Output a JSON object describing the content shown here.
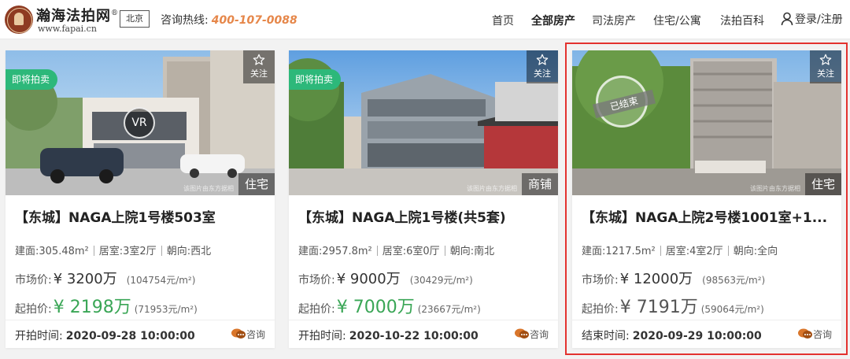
{
  "header": {
    "brand": "瀚海法拍网",
    "brand_mark": "®",
    "domain": "www.fapai.cn",
    "city": "北京",
    "hotline_label": "咨询热线:",
    "hotline_number": "400-107-0088",
    "nav": [
      {
        "label": "首页",
        "active": false
      },
      {
        "label": "全部房产",
        "active": true
      },
      {
        "label": "司法房产",
        "active": false
      },
      {
        "label": "住宅/公寓",
        "active": false
      },
      {
        "label": "法拍百科",
        "active": false
      }
    ],
    "login": "登录/注册"
  },
  "cards": [
    {
      "status_badge": "即将拍卖",
      "fav_label": "关注",
      "type": "住宅",
      "vr": "VR",
      "watermark": "该图片由东方据相",
      "title": "【东城】NAGA上院1号楼503室",
      "spec": {
        "area": "建面:305.48m²",
        "rooms": "居室:3室2厅",
        "orient": "朝向:西北"
      },
      "market_label": "市场价:",
      "market_price": "¥ 3200万",
      "market_unit": "(104754元/m²)",
      "start_label": "起拍价:",
      "start_price": "¥ 2198万",
      "start_unit": "(71953元/m²)",
      "time_label": "开拍时间:",
      "time_value": "2020-09-28 10:00:00",
      "consult": "咨询"
    },
    {
      "status_badge": "即将拍卖",
      "fav_label": "关注",
      "type": "商铺",
      "watermark": "该图片由东方据相",
      "title": "【东城】NAGA上院1号楼(共5套)",
      "spec": {
        "area": "建面:2957.8m²",
        "rooms": "居室:6室0厅",
        "orient": "朝向:南北"
      },
      "market_label": "市场价:",
      "market_price": "¥ 9000万",
      "market_unit": "(30429元/m²)",
      "start_label": "起拍价:",
      "start_price": "¥ 7000万",
      "start_unit": "(23667元/m²)",
      "time_label": "开拍时间:",
      "time_value": "2020-10-22 10:00:00",
      "consult": "咨询"
    },
    {
      "stamp": "已结束",
      "fav_label": "关注",
      "type": "住宅",
      "watermark": "该图片由东方据相",
      "title": "【东城】NAGA上院2号楼1001室+1...",
      "spec": {
        "area": "建面:1217.5m²",
        "rooms": "居室:4室2厅",
        "orient": "朝向:全向"
      },
      "market_label": "市场价:",
      "market_price": "¥ 12000万",
      "market_unit": "(98563元/m²)",
      "start_label": "起拍价:",
      "start_price": "¥ 7191万",
      "start_unit": "(59064元/m²)",
      "time_label": "结束时间:",
      "time_value": "2020-09-29 10:00:00",
      "consult": "咨询"
    }
  ],
  "colors": {
    "accent_green": "#2db87a",
    "price_green": "#3aa656",
    "hotline_orange": "#e6874a",
    "highlight_red": "#e3322f"
  }
}
